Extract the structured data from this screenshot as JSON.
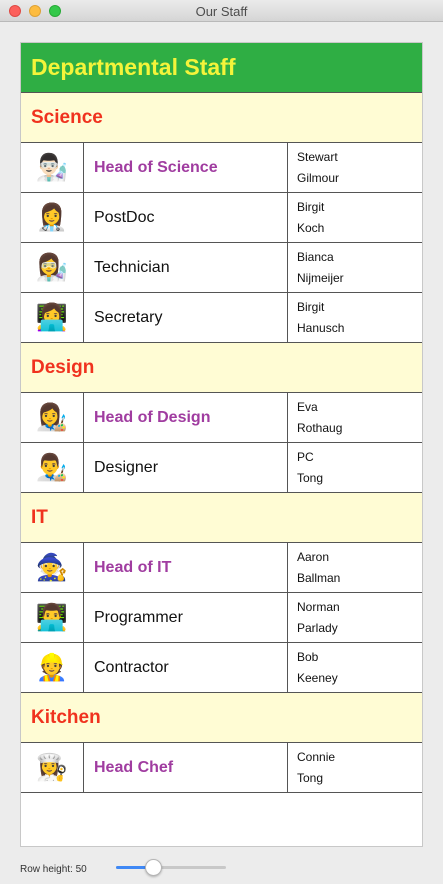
{
  "window": {
    "title": "Our Staff"
  },
  "table": {
    "title": "Departmental Staff",
    "sections": [
      {
        "name": "Science",
        "rows": [
          {
            "icon": "👨🏻‍🔬",
            "icon_name": "santa-emoji",
            "role": "Head of Science",
            "is_head": true,
            "first": "Stewart",
            "last": "Gilmour"
          },
          {
            "icon": "👩‍⚕️",
            "icon_name": "health-worker-emoji",
            "role": "PostDoc",
            "is_head": false,
            "first": "Birgit",
            "last": "Koch"
          },
          {
            "icon": "👩‍🔬",
            "icon_name": "scientist-emoji",
            "role": "Technician",
            "is_head": false,
            "first": "Bianca",
            "last": "Nijmeijer"
          },
          {
            "icon": "👩‍💻",
            "icon_name": "technologist-emoji",
            "role": "Secretary",
            "is_head": false,
            "first": "Birgit",
            "last": "Hanusch"
          }
        ]
      },
      {
        "name": "Design",
        "rows": [
          {
            "icon": "👩‍🎨",
            "icon_name": "artist-emoji",
            "role": "Head of Design",
            "is_head": true,
            "first": "Eva",
            "last": "Rothaug"
          },
          {
            "icon": "👨‍🎨",
            "icon_name": "artist-emoji",
            "role": "Designer",
            "is_head": false,
            "first": "PC",
            "last": "Tong"
          }
        ]
      },
      {
        "name": "IT",
        "rows": [
          {
            "icon": "🧙",
            "icon_name": "mage-emoji",
            "role": "Head of IT",
            "is_head": true,
            "first": "Aaron",
            "last": "Ballman"
          },
          {
            "icon": "👨‍💻",
            "icon_name": "technologist-emoji",
            "role": "Programmer",
            "is_head": false,
            "first": "Norman",
            "last": "Parlady"
          },
          {
            "icon": "👷",
            "icon_name": "construction-worker-emoji",
            "role": "Contractor",
            "is_head": false,
            "first": "Bob",
            "last": "Keeney"
          }
        ]
      },
      {
        "name": "Kitchen",
        "rows": [
          {
            "icon": "👩‍🍳",
            "icon_name": "cook-emoji",
            "role": "Head Chef",
            "is_head": true,
            "first": "Connie",
            "last": "Tong"
          }
        ]
      }
    ]
  },
  "footer": {
    "row_height_label": "Row height: 50",
    "slider_fraction": 0.31
  },
  "colors": {
    "header_bg": "#2fae44",
    "header_text": "#f4f43a",
    "section_bg": "#fffcd4",
    "section_text": "#f0321e",
    "head_role_text": "#a03ca0",
    "slider_accent": "#3f88f5"
  }
}
